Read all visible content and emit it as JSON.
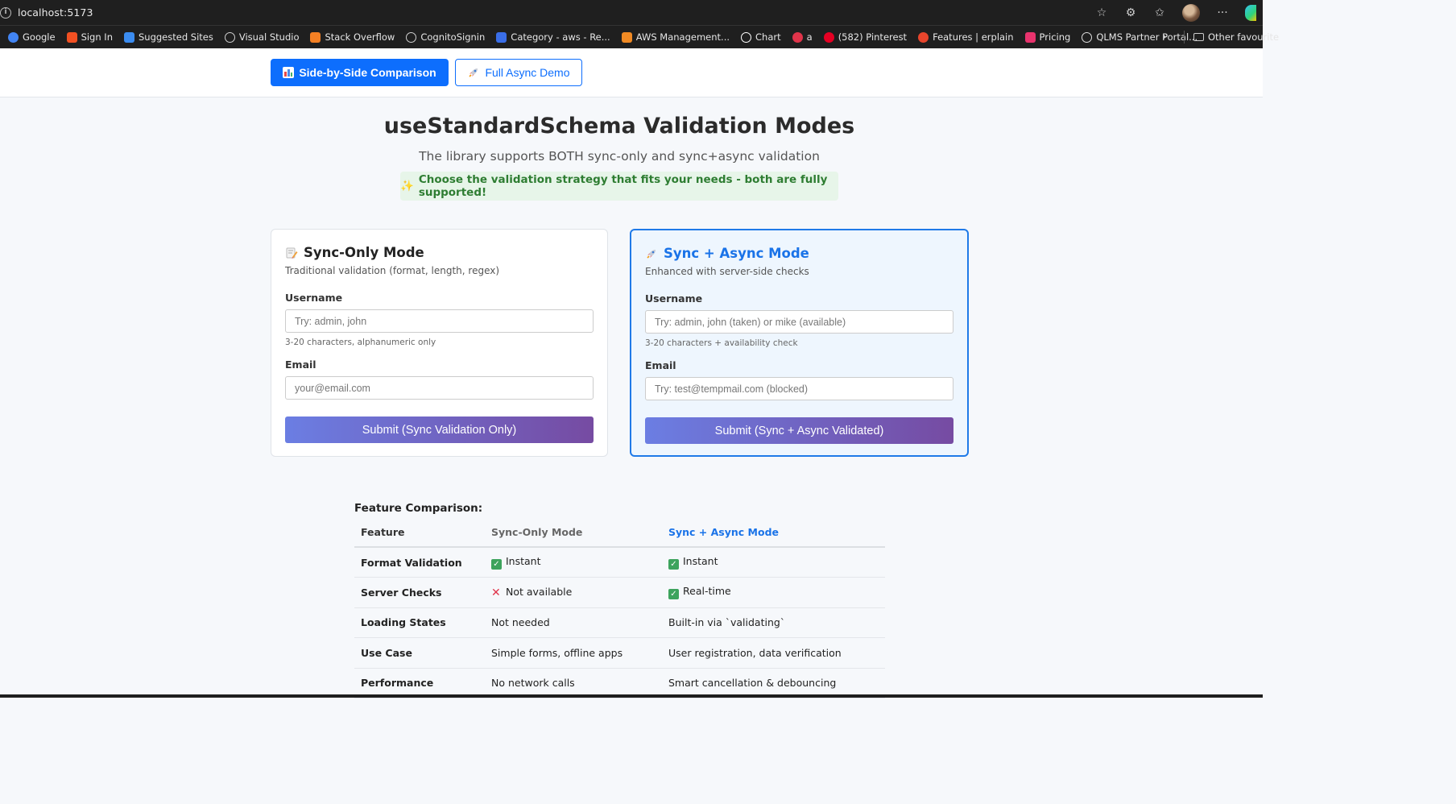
{
  "browser": {
    "url": "localhost:5173",
    "bookmarks": [
      {
        "label": "Google",
        "icon": "google-icon",
        "color": "#4285f4"
      },
      {
        "label": "Sign In",
        "icon": "microsoft-icon",
        "color": "#f25022"
      },
      {
        "label": "Suggested Sites",
        "icon": "search-icon",
        "color": "#3b8cf0"
      },
      {
        "label": "Visual Studio",
        "icon": "globe-icon",
        "color": "#cfcfcf"
      },
      {
        "label": "Stack Overflow",
        "icon": "stackoverflow-icon",
        "color": "#f48024"
      },
      {
        "label": "CognitoSignin",
        "icon": "globe-icon",
        "color": "#cfcfcf"
      },
      {
        "label": "Category - aws - Re...",
        "icon": "aws-icon",
        "color": "#3a6ee8"
      },
      {
        "label": "AWS Management...",
        "icon": "aws-console-icon",
        "color": "#f08a24"
      },
      {
        "label": "Chart",
        "icon": "flag-icon",
        "color": "#ffffff"
      },
      {
        "label": "a",
        "icon": "spiral-icon",
        "color": "#e0344a"
      },
      {
        "label": "(582) Pinterest",
        "icon": "pinterest-icon",
        "color": "#e60023"
      },
      {
        "label": "Features | erplain",
        "icon": "erplain-icon",
        "color": "#e8452c"
      },
      {
        "label": "Pricing",
        "icon": "heart-icon",
        "color": "#e8336d"
      },
      {
        "label": "QLMS Partner Portal...",
        "icon": "github-icon",
        "color": "#dddddd"
      }
    ],
    "other_favourites": "Other favourite"
  },
  "nav": {
    "primary_label": "Side-by-Side Comparison",
    "secondary_label": "Full Async Demo"
  },
  "header": {
    "title": "useStandardSchema Validation Modes",
    "subtitle": "The library supports BOTH sync-only and sync+async validation",
    "banner": "Choose the validation strategy that fits your needs - both are fully supported!"
  },
  "sync_card": {
    "title": "Sync-Only Mode",
    "description": "Traditional validation (format, length, regex)",
    "username_label": "Username",
    "username_placeholder": "Try: admin, john",
    "username_hint": "3-20 characters, alphanumeric only",
    "email_label": "Email",
    "email_placeholder": "your@email.com",
    "submit_label": "Submit (Sync Validation Only)"
  },
  "async_card": {
    "title": "Sync + Async Mode",
    "description": "Enhanced with server-side checks",
    "username_label": "Username",
    "username_placeholder": "Try: admin, john (taken) or mike (available)",
    "username_hint": "3-20 characters + availability check",
    "email_label": "Email",
    "email_placeholder": "Try: test@tempmail.com (blocked)",
    "submit_label": "Submit (Sync + Async Validated)"
  },
  "comparison": {
    "title": "Feature Comparison:",
    "headers": [
      "Feature",
      "Sync-Only Mode",
      "Sync + Async Mode"
    ],
    "rows": [
      {
        "feature": "Format Validation",
        "sync": "Instant",
        "sync_icon": "check",
        "async": "Instant",
        "async_icon": "check"
      },
      {
        "feature": "Server Checks",
        "sync": "Not available",
        "sync_icon": "cross",
        "async": "Real-time",
        "async_icon": "check"
      },
      {
        "feature": "Loading States",
        "sync": "Not needed",
        "sync_icon": "",
        "async": "Built-in via `validating`",
        "async_icon": ""
      },
      {
        "feature": "Use Case",
        "sync": "Simple forms, offline apps",
        "sync_icon": "",
        "async": "User registration, data verification",
        "async_icon": ""
      },
      {
        "feature": "Performance",
        "sync": "No network calls",
        "sync_icon": "",
        "async": "Smart cancellation & debouncing",
        "async_icon": ""
      }
    ]
  },
  "colors": {
    "primary": "#0d6efd",
    "accent_blue": "#1a73e8",
    "success_green": "#2e7d32",
    "gradient_start": "#6b7ee3",
    "gradient_end": "#764ba2"
  }
}
